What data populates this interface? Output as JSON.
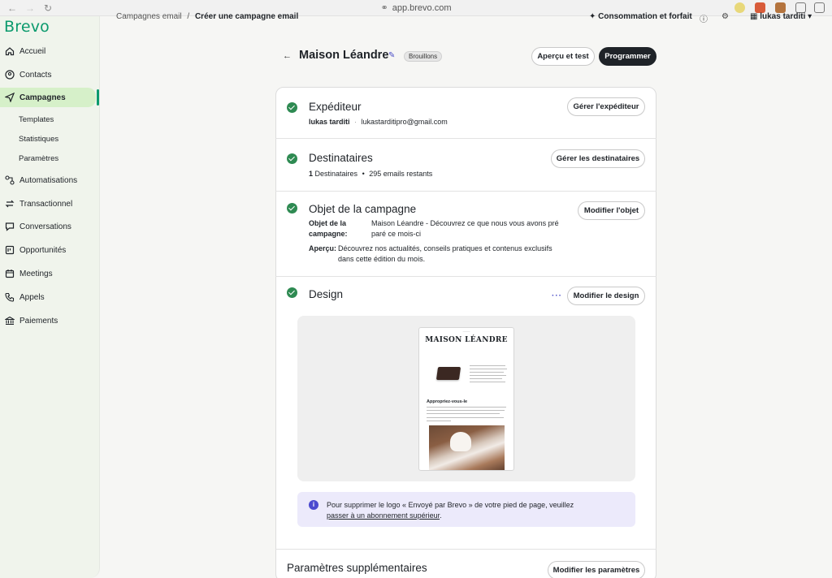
{
  "browser": {
    "url": "app.brevo.com"
  },
  "header": {
    "breadcrumb_parent": "Campagnes email",
    "breadcrumb_sep": "/",
    "breadcrumb_current": "Créer une campagne email",
    "consumption": "Consommation et forfait",
    "user_name": "lukas tarditi"
  },
  "sidebar": {
    "logo": "Brevo",
    "items": [
      {
        "label": "Accueil"
      },
      {
        "label": "Contacts"
      },
      {
        "label": "Campagnes"
      },
      {
        "label": "Automatisations"
      },
      {
        "label": "Transactionnel"
      },
      {
        "label": "Conversations"
      },
      {
        "label": "Opportunités"
      },
      {
        "label": "Meetings"
      },
      {
        "label": "Appels"
      },
      {
        "label": "Paiements"
      }
    ],
    "subitems": [
      {
        "label": "Templates"
      },
      {
        "label": "Statistiques"
      },
      {
        "label": "Paramètres"
      }
    ]
  },
  "campaign": {
    "name": "Maison Léandre",
    "status": "Brouillons",
    "preview_button": "Aperçu et test",
    "schedule_button": "Programmer"
  },
  "sections": {
    "sender": {
      "title": "Expéditeur",
      "name": "lukas tarditi",
      "separator": "·",
      "email": "lukastarditipro@gmail.com",
      "button": "Gérer l'expéditeur"
    },
    "recipients": {
      "title": "Destinataires",
      "count": "1",
      "count_label": "Destinataires",
      "bullet": "•",
      "remaining": "295 emails restants",
      "button": "Gérer les destinataires"
    },
    "subject": {
      "title": "Objet de la campagne",
      "subject_label_1": "Objet de la",
      "subject_label_2": "campagne:",
      "subject_value_1": "Maison Léandre - Découvrez ce que nous vous avons pré",
      "subject_value_2": "paré ce mois-ci",
      "preview_label": "Aperçu:",
      "preview_value_1": "Découvrez nos actualités, conseils pratiques et contenus exclusifs",
      "preview_value_2": "dans cette édition du mois.",
      "button": "Modifier l'objet"
    },
    "design": {
      "title": "Design",
      "more": "···",
      "button": "Modifier le design",
      "email_brand": "MAISON LÉANDRE",
      "email_heading": "Appropriez-vous-le"
    },
    "notice": {
      "text": "Pour supprimer le logo « Envoyé par Brevo » de votre pied de page, veuillez",
      "link": "passer à un abonnement supérieur",
      "end": "."
    },
    "extra": {
      "title": "Paramètres supplémentaires",
      "button": "Modifier les paramètres"
    }
  }
}
